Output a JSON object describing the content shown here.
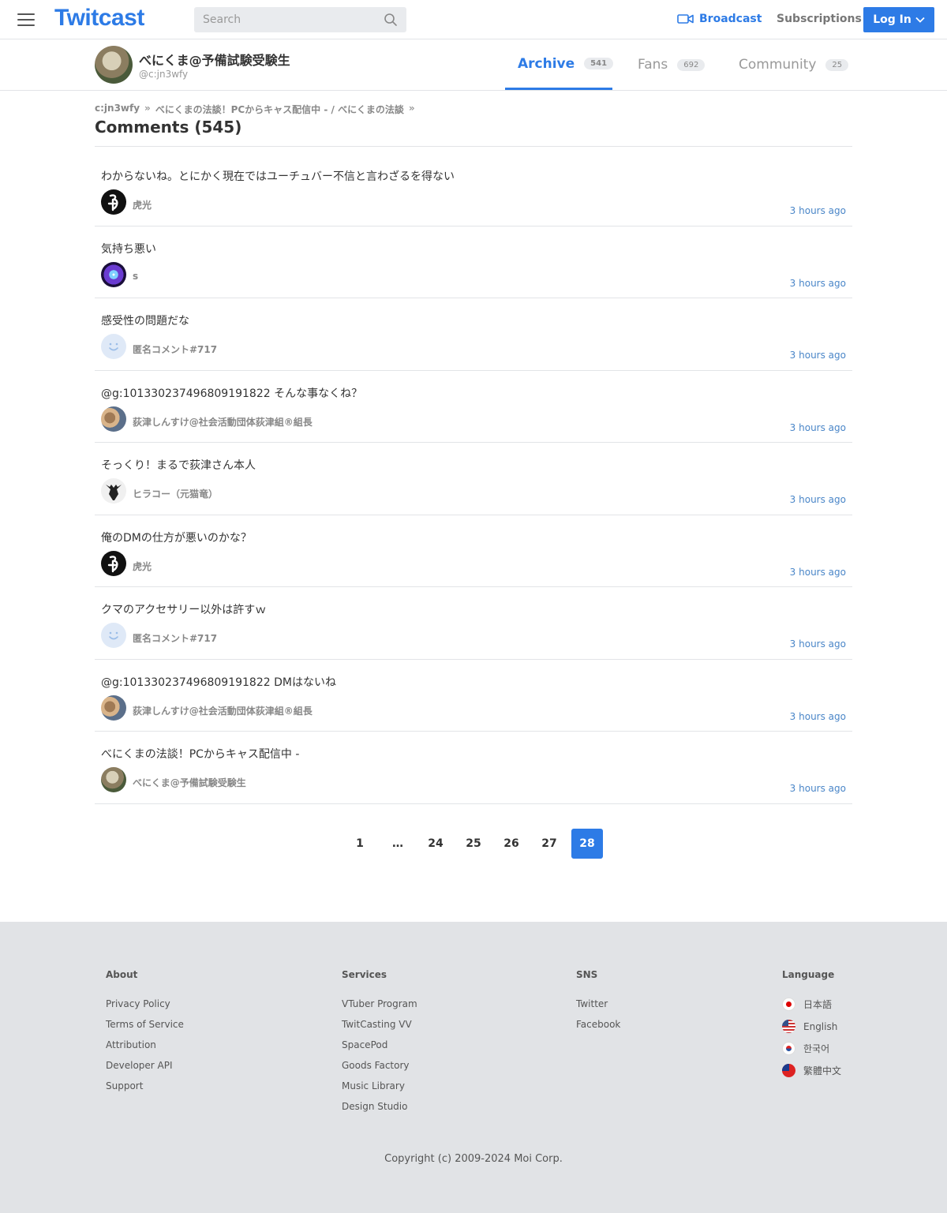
{
  "header": {
    "logo": "Twitcast",
    "search_placeholder": "Search",
    "broadcast_label": "Broadcast",
    "subscriptions_label": "Subscriptions",
    "login_label": "Log In",
    "accent_color": "#2d7be6"
  },
  "profile": {
    "name": "べにくま@予備試験受験生",
    "id": "@c:jn3wfy",
    "tabs": [
      {
        "label": "Archive",
        "count": "541"
      },
      {
        "label": "Fans",
        "count": "692"
      },
      {
        "label": "Community",
        "count": "25"
      }
    ]
  },
  "breadcrumb": {
    "items": [
      "c:jn3wfy",
      "べにくまの法談！PCからキャス配信中 - / べにくまの法談"
    ],
    "separator": "»"
  },
  "page_title": "Comments (545)",
  "comments": [
    {
      "text": "わからないね。とにかく現在ではユーチュバー不信と言わざるを得ない",
      "user": "虎光",
      "time": "3 hours ago"
    },
    {
      "text": "気持ち悪い",
      "user": "s",
      "time": "3 hours ago"
    },
    {
      "text": "感受性の問題だな",
      "user": "匿名コメント#717",
      "time": "3 hours ago"
    },
    {
      "text": "@g:101330237496809191822 そんな事なくね？",
      "user": "荻津しんすけ@社会活動団体荻津組®組長",
      "time": "3 hours ago"
    },
    {
      "text": "そっくり！まるで荻津さん本人",
      "user": "ヒラコー（元猫竜）",
      "time": "3 hours ago"
    },
    {
      "text": "俺のDMの仕方が悪いのかな？",
      "user": "虎光",
      "time": "3 hours ago"
    },
    {
      "text": "クマのアクセサリー以外は許すｗ",
      "user": "匿名コメント#717",
      "time": "3 hours ago"
    },
    {
      "text": "@g:101330237496809191822 DMはないね",
      "user": "荻津しんすけ@社会活動団体荻津組®組長",
      "time": "3 hours ago"
    },
    {
      "text": "べにくまの法談！PCからキャス配信中 -",
      "user": "べにくま@予備試験受験生",
      "time": "3 hours ago"
    }
  ],
  "pagination": {
    "pages": [
      "1",
      "…",
      "24",
      "25",
      "26",
      "27",
      "28"
    ],
    "current": "28"
  },
  "footer": {
    "about": {
      "heading": "About",
      "links": [
        "Privacy Policy",
        "Terms of Service",
        "Attribution",
        "Developer API",
        "Support"
      ]
    },
    "services": {
      "heading": "Services",
      "links": [
        "VTuber Program",
        "TwitCasting VV",
        "SpacePod",
        "Goods Factory",
        "Music Library",
        "Design Studio"
      ]
    },
    "sns": {
      "heading": "SNS",
      "links": [
        "Twitter",
        "Facebook"
      ]
    },
    "language": {
      "heading": "Language",
      "links": [
        "日本語",
        "English",
        "한국어",
        "繁體中文"
      ]
    },
    "copyright": "Copyright (c) 2009-2024 Moi Corp."
  }
}
